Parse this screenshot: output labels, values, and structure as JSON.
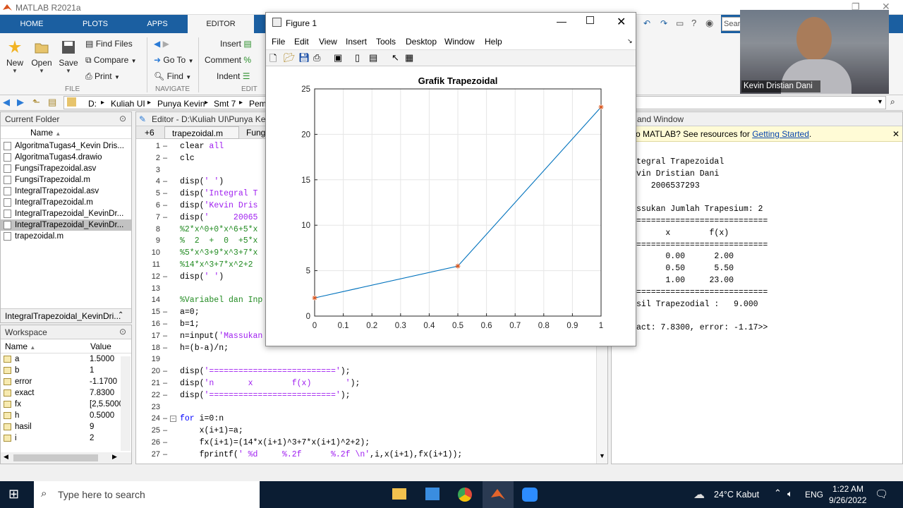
{
  "app": {
    "title": "MATLAB R2021a"
  },
  "toolstrip": {
    "tabs": [
      "HOME",
      "PLOTS",
      "APPS",
      "EDITOR"
    ],
    "new": "New",
    "open": "Open",
    "save": "Save",
    "find_files": "Find Files",
    "compare": "Compare",
    "print": "Print",
    "go_to": "Go To",
    "find": "Find",
    "insert": "Insert",
    "comment": "Comment",
    "indent": "Indent",
    "groups": {
      "file": "FILE",
      "navigate": "NAVIGATE",
      "edit": "EDIT"
    },
    "search_placeholder": "Searc"
  },
  "address": {
    "path": [
      "D:",
      "Kuliah UI",
      "Punya Kevin",
      "Smt 7",
      "Pem"
    ]
  },
  "current_folder": {
    "title": "Current Folder",
    "col_name": "Name",
    "files": [
      "AlgoritmaTugas4_Kevin Dris...",
      "AlgoritmaTugas4.drawio",
      "FungsiTrapezoidal.asv",
      "FungsiTrapezoidal.m",
      "IntegralTrapezoidal.asv",
      "IntegralTrapezoidal.m",
      "IntegralTrapezoidal_KevinDr...",
      "IntegralTrapezoidal_KevinDr...",
      "trapezoidal.m"
    ],
    "selected_index": 7,
    "details": "IntegralTrapezoidal_KevinDri..."
  },
  "workspace": {
    "title": "Workspace",
    "col_name": "Name",
    "col_value": "Value",
    "vars": [
      {
        "name": "a",
        "value": "1.5000"
      },
      {
        "name": "b",
        "value": "1"
      },
      {
        "name": "error",
        "value": "-1.1700"
      },
      {
        "name": "exact",
        "value": "7.8300"
      },
      {
        "name": "fx",
        "value": "[2,5.5000"
      },
      {
        "name": "h",
        "value": "0.5000"
      },
      {
        "name": "hasil",
        "value": "9"
      },
      {
        "name": "i",
        "value": "2"
      }
    ]
  },
  "editor": {
    "title": "Editor - D:\\Kuliah UI\\Punya Kevin",
    "tab_more": "+6",
    "tabs": [
      "trapezoidal.m",
      "Fungsi"
    ],
    "lines": [
      {
        "n": "1",
        "d": "–",
        "segs": [
          {
            "t": "clear ",
            "c": ""
          },
          {
            "t": "all",
            "c": "str"
          }
        ]
      },
      {
        "n": "2",
        "d": "–",
        "segs": [
          {
            "t": "clc",
            "c": ""
          }
        ]
      },
      {
        "n": "3",
        "d": "",
        "segs": []
      },
      {
        "n": "4",
        "d": "–",
        "segs": [
          {
            "t": "disp(",
            "c": ""
          },
          {
            "t": "' '",
            "c": "str"
          },
          {
            "t": ")",
            "c": ""
          }
        ]
      },
      {
        "n": "5",
        "d": "–",
        "segs": [
          {
            "t": "disp(",
            "c": ""
          },
          {
            "t": "'Integral T",
            "c": "str"
          }
        ]
      },
      {
        "n": "6",
        "d": "–",
        "segs": [
          {
            "t": "disp(",
            "c": ""
          },
          {
            "t": "'Kevin Dris",
            "c": "str"
          }
        ]
      },
      {
        "n": "7",
        "d": "–",
        "segs": [
          {
            "t": "disp(",
            "c": ""
          },
          {
            "t": "'     20065",
            "c": "str"
          }
        ]
      },
      {
        "n": "8",
        "d": "",
        "segs": [
          {
            "t": "%2*x^0+0*x^6+5*x",
            "c": "cmt"
          }
        ]
      },
      {
        "n": "9",
        "d": "",
        "segs": [
          {
            "t": "%  2  +  0  +5*x",
            "c": "cmt"
          }
        ]
      },
      {
        "n": "10",
        "d": "",
        "segs": [
          {
            "t": "%5*x^3+9*x^3+7*x",
            "c": "cmt"
          }
        ]
      },
      {
        "n": "11",
        "d": "",
        "segs": [
          {
            "t": "%14*x^3+7*x^2+2",
            "c": "cmt"
          }
        ]
      },
      {
        "n": "12",
        "d": "–",
        "segs": [
          {
            "t": "disp(",
            "c": ""
          },
          {
            "t": "' '",
            "c": "str"
          },
          {
            "t": ")",
            "c": ""
          }
        ]
      },
      {
        "n": "13",
        "d": "",
        "segs": []
      },
      {
        "n": "14",
        "d": "",
        "segs": [
          {
            "t": "%Variabel dan Inp",
            "c": "cmt"
          }
        ]
      },
      {
        "n": "15",
        "d": "–",
        "segs": [
          {
            "t": "a=0;",
            "c": ""
          }
        ]
      },
      {
        "n": "16",
        "d": "–",
        "segs": [
          {
            "t": "b=1;",
            "c": ""
          }
        ]
      },
      {
        "n": "17",
        "d": "–",
        "segs": [
          {
            "t": "n=input(",
            "c": ""
          },
          {
            "t": "'Massukan",
            "c": "str"
          }
        ]
      },
      {
        "n": "18",
        "d": "–",
        "segs": [
          {
            "t": "h=(b-a)/n;",
            "c": ""
          }
        ]
      },
      {
        "n": "19",
        "d": "",
        "segs": []
      },
      {
        "n": "20",
        "d": "–",
        "segs": [
          {
            "t": "disp(",
            "c": ""
          },
          {
            "t": "'=========================='",
            "c": "str"
          },
          {
            "t": ");",
            "c": ""
          }
        ]
      },
      {
        "n": "21",
        "d": "–",
        "segs": [
          {
            "t": "disp(",
            "c": ""
          },
          {
            "t": "'n       x        f(x)       '",
            "c": "str"
          },
          {
            "t": ");",
            "c": ""
          }
        ]
      },
      {
        "n": "22",
        "d": "–",
        "segs": [
          {
            "t": "disp(",
            "c": ""
          },
          {
            "t": "'=========================='",
            "c": "str"
          },
          {
            "t": ");",
            "c": ""
          }
        ]
      },
      {
        "n": "23",
        "d": "",
        "segs": []
      },
      {
        "n": "24",
        "d": "–",
        "segs": [
          {
            "t": "for",
            "c": "kw"
          },
          {
            "t": " i=0:n",
            "c": ""
          }
        ]
      },
      {
        "n": "25",
        "d": "–",
        "segs": [
          {
            "t": "    x(i+1)=a;",
            "c": ""
          }
        ]
      },
      {
        "n": "26",
        "d": "–",
        "segs": [
          {
            "t": "    fx(i+1)=(14*x(i+1)^3+7*x(i+1)^2+2);",
            "c": ""
          }
        ]
      },
      {
        "n": "27",
        "d": "–",
        "segs": [
          {
            "t": "    fprintf(",
            "c": ""
          },
          {
            "t": "' %d     %.2f      %.2f \\n'",
            "c": "str"
          },
          {
            "t": ",i,x(i+1),fx(i+1));",
            "c": ""
          }
        ]
      }
    ]
  },
  "command_window": {
    "title": "and Window",
    "notice": "o MATLAB? See resources for ",
    "notice_link": "Getting Started",
    "notice_end": ".",
    "lines": [
      "tegral Trapezoidal",
      "vin Dristian Dani",
      "   2006537293",
      "",
      "ssukan Jumlah Trapesium: 2",
      "===========================",
      "      x        f(x)",
      "===========================",
      "      0.00      2.00",
      "      0.50      5.50",
      "      1.00     23.00",
      "===========================",
      "sil Trapezodial :   9.000",
      "",
      "act: 7.8300, error: -1.17>>"
    ]
  },
  "figure": {
    "title": "Figure 1",
    "menu": [
      "File",
      "Edit",
      "View",
      "Insert",
      "Tools",
      "Desktop",
      "Window",
      "Help"
    ]
  },
  "chart_data": {
    "type": "line",
    "title": "Grafik Trapezoidal",
    "x": [
      0,
      0.5,
      1
    ],
    "y": [
      2,
      5.5,
      23
    ],
    "xlim": [
      0,
      1
    ],
    "ylim": [
      0,
      25
    ],
    "xticks": [
      "0",
      "0.1",
      "0.2",
      "0.3",
      "0.4",
      "0.5",
      "0.6",
      "0.7",
      "0.8",
      "0.9",
      "1"
    ],
    "yticks": [
      "0",
      "5",
      "10",
      "15",
      "20",
      "25"
    ],
    "grid": true,
    "line_color": "#0072bd",
    "marker_color": "#d95319"
  },
  "webcam": {
    "name": "Kevin Dristian Dani"
  },
  "taskbar": {
    "search": "Type here to search",
    "weather": "24°C  Kabut",
    "lang": "ENG",
    "time": "1:22 AM",
    "date": "9/26/2022"
  }
}
